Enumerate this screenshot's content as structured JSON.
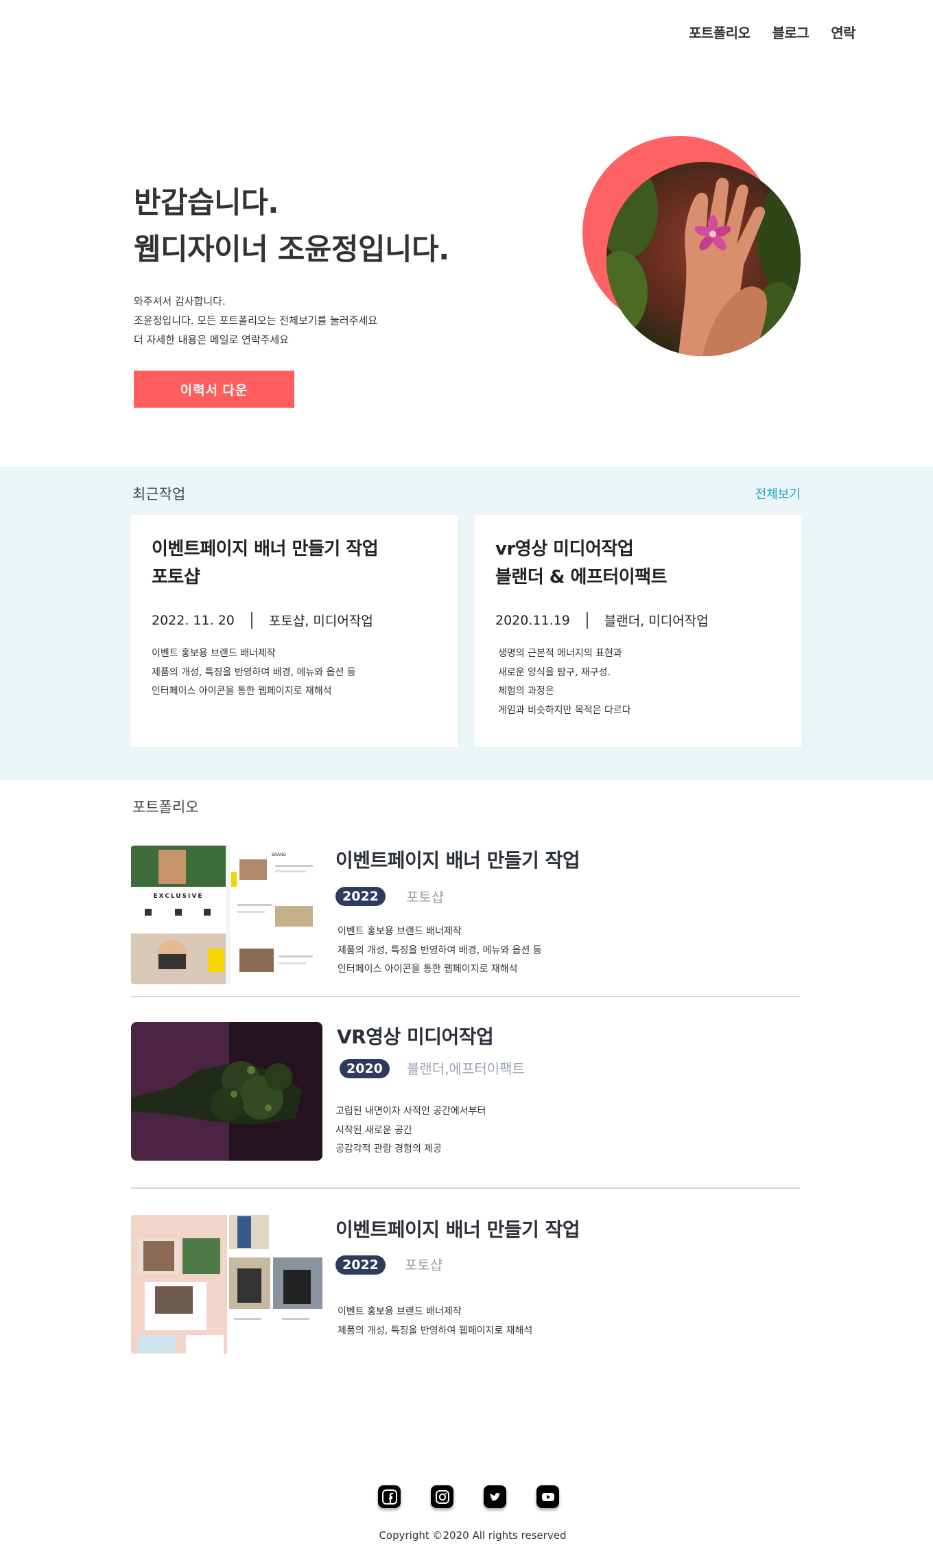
{
  "nav": {
    "items": [
      "포트폴리오",
      "블로그",
      "연락"
    ]
  },
  "hero": {
    "title_line1": "반갑습니다.",
    "title_line2": "웹디자이너 조윤정입니다.",
    "desc": [
      "와주셔서 감사합니다.",
      "조윤정입니다. 모든 포트폴리오는 전체보기를 눌러주세요",
      "더 자세한 내용은 메일로 연락주세요"
    ],
    "button": "이력서 다운"
  },
  "recent": {
    "heading": "최근작업",
    "view_all": "전체보기",
    "cards": [
      {
        "title_line1": "이벤트페이지 배너 만들기 작업",
        "title_line2": "포토샵",
        "date": "2022. 11. 20",
        "category": "포토샵, 미디어작업",
        "desc": [
          "이벤트 홍보용 브랜드 배너제작",
          "제품의 개성, 특징을 반영하여 배경, 메뉴와 옵션 등",
          "인터페이스 아이콘을 통한 웹페이지로 재해석"
        ]
      },
      {
        "title_line1": "vr영상 미디어작업",
        "title_line2": "블랜더 & 에프터이팩트",
        "date": "2020.11.19",
        "category": "블랜더, 미디어작업",
        "desc": [
          "생명의 근본적 에너지의 표현과",
          "새로운 양식을 탐구, 재구성.",
          "체험의 과정은",
          "게임과 비슷하지만 목적은 다르다"
        ]
      }
    ]
  },
  "portfolio": {
    "heading": "포트폴리오",
    "items": [
      {
        "title": "이벤트페이지 배너 만들기 작업",
        "year": "2022",
        "category": "포토샵",
        "desc": [
          "이벤트 홍보용 브랜드 배너제작",
          "제품의 개성, 특징을 반영하여 배경, 메뉴와 옵션 등",
          "인터페이스 아이콘을 통한 웹페이지로 재해석"
        ],
        "thumb_text": [
          "EXCLUSIVE",
          "BRAND"
        ]
      },
      {
        "title": "VR영상 미디어작업",
        "year": "2020",
        "category": "블랜더,에프터이팩트",
        "desc": [
          "고립된 내면이자 사적인 공간에서부터",
          "시작된 새로운 공간",
          "공감각적 관람 경험의 제공"
        ]
      },
      {
        "title": "이벤트페이지 배너 만들기 작업",
        "year": "2022",
        "category": "포토샵",
        "desc": [
          "이벤트 홍보용 브랜드 배너제작",
          "제품의 개성, 특징을 반영하여 웹페이지로 재해석"
        ]
      }
    ]
  },
  "footer": {
    "social_icons": [
      "facebook-icon",
      "instagram-icon",
      "twitter-icon",
      "youtube-icon"
    ],
    "copyright": "Copyright ©2020 All rights reserved"
  },
  "colors": {
    "accent": "#ff5e5e",
    "recent_bg": "#ebf5f7",
    "link": "#1fa4c2",
    "badge": "#2d3c5e",
    "muted": "#9aa3b4"
  }
}
